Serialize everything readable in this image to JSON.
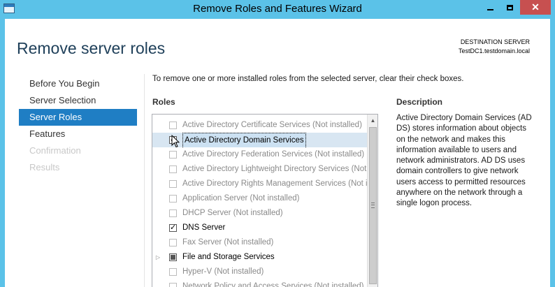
{
  "window": {
    "title": "Remove Roles and Features Wizard",
    "minimize": "minimize-icon",
    "maximize": "maximize-icon",
    "close_label": "✕"
  },
  "header": {
    "title": "Remove server roles",
    "destination_label": "DESTINATION SERVER",
    "destination_name": "TestDC1.testdomain.local"
  },
  "nav": {
    "items": [
      {
        "label": "Before You Begin",
        "state": "normal"
      },
      {
        "label": "Server Selection",
        "state": "normal"
      },
      {
        "label": "Server Roles",
        "state": "active"
      },
      {
        "label": "Features",
        "state": "normal"
      },
      {
        "label": "Confirmation",
        "state": "disabled"
      },
      {
        "label": "Results",
        "state": "disabled"
      }
    ]
  },
  "main": {
    "instructions": "To remove one or more installed roles from the selected server, clear their check boxes.",
    "roles_heading": "Roles",
    "roles": [
      {
        "label": "Active Directory Certificate Services (Not installed)",
        "checked": false,
        "muted": true
      },
      {
        "label": "Active Directory Domain Services",
        "checked": true,
        "muted": false,
        "selected": true
      },
      {
        "label": "Active Directory Federation Services (Not installed)",
        "checked": false,
        "muted": true
      },
      {
        "label": "Active Directory Lightweight Directory Services (Not installed)",
        "checked": false,
        "muted": true
      },
      {
        "label": "Active Directory Rights Management Services (Not installed)",
        "checked": false,
        "muted": true
      },
      {
        "label": "Application Server (Not installed)",
        "checked": false,
        "muted": true
      },
      {
        "label": "DHCP Server (Not installed)",
        "checked": false,
        "muted": true
      },
      {
        "label": "DNS Server",
        "checked": true,
        "muted": false
      },
      {
        "label": "Fax Server (Not installed)",
        "checked": false,
        "muted": true
      },
      {
        "label": "File and Storage Services",
        "checked": "partial",
        "muted": false,
        "expandable": true
      },
      {
        "label": "Hyper-V (Not installed)",
        "checked": false,
        "muted": true
      },
      {
        "label": "Network Policy and Access Services (Not installed)",
        "checked": false,
        "muted": true
      }
    ],
    "description_heading": "Description",
    "description_text": "Active Directory Domain Services (AD DS) stores information about objects on the network and makes this information available to users and network administrators. AD DS uses domain controllers to give network users access to permitted resources anywhere on the network through a single logon process."
  },
  "colors": {
    "titlebar": "#5bc2e8",
    "close": "#c75050",
    "nav_active": "#1f7ec4",
    "header_text": "#1e3f59"
  }
}
